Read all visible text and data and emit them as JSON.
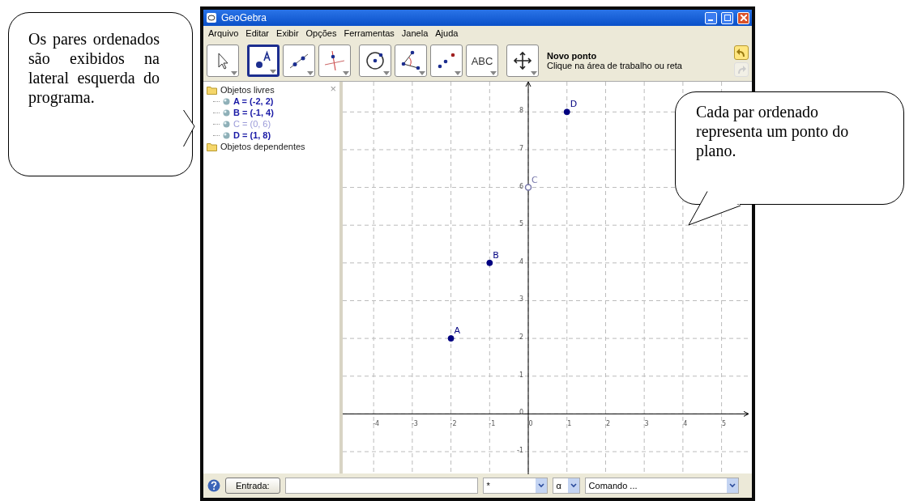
{
  "callouts": [
    {
      "kind": "left",
      "text": "Os pares ordenados são exibidos na lateral esquerda do programa."
    },
    {
      "kind": "right",
      "text": "Cada par ordenado representa um ponto do plano."
    }
  ],
  "window": {
    "title": "GeoGebra",
    "menu": [
      "Arquivo",
      "Editar",
      "Exibir",
      "Opções",
      "Ferramentas",
      "Janela",
      "Ajuda"
    ],
    "tools": [
      {
        "kind": "move",
        "selected": false
      },
      {
        "kind": "point",
        "selected": true
      },
      {
        "kind": "line",
        "selected": false
      },
      {
        "kind": "perpendicular",
        "selected": false
      },
      {
        "kind": "circle",
        "selected": false
      },
      {
        "kind": "angle",
        "selected": false
      },
      {
        "kind": "reflect",
        "selected": false
      },
      {
        "kind": "text",
        "label": "ABC",
        "selected": false
      },
      {
        "kind": "pan",
        "selected": false
      }
    ],
    "tool_info": {
      "title": "Novo ponto",
      "hint": "Clique na área de trabalho ou reta"
    },
    "actions": [
      {
        "kind": "undo",
        "disabled": false
      },
      {
        "kind": "redo",
        "disabled": true
      }
    ],
    "algebra_close": "×",
    "algebra_view": [
      {
        "label": "Objetos livres",
        "children": [
          {
            "label": "A = (-2, 2)",
            "dimmed": false
          },
          {
            "label": "B = (-1, 4)",
            "dimmed": false
          },
          {
            "label": "C = (0, 6)",
            "dimmed": true
          },
          {
            "label": "D = (1, 8)",
            "dimmed": false
          }
        ]
      },
      {
        "label": "Objetos dependentes"
      }
    ],
    "graphics": {
      "chart_data": {
        "type": "scatter",
        "x": [
          -2,
          -1,
          0,
          1
        ],
        "series": [
          {
            "color": "#000080",
            "values": [
              2,
              4,
              null,
              8
            ]
          },
          {
            "color": "#7777aa",
            "values": [
              null,
              null,
              6,
              null
            ]
          }
        ],
        "grid": true,
        "xlim": [
          -4.8,
          5.7
        ],
        "ylim": [
          -1.6,
          8.8
        ],
        "xticks": [
          -4,
          -3,
          -2,
          -1,
          0,
          1,
          2,
          3,
          4,
          5
        ],
        "yticks": [
          -1,
          0,
          1,
          2,
          3,
          4,
          5,
          6,
          7,
          8
        ],
        "annotations": [
          {
            "x": -2,
            "y": 2,
            "text": "A"
          },
          {
            "x": -1,
            "y": 4,
            "text": "B"
          },
          {
            "x": 0,
            "y": 6,
            "text": "C"
          },
          {
            "x": 1,
            "y": 8,
            "text": "D"
          }
        ]
      }
    },
    "input_bar": {
      "button": "Entrada:",
      "symbols": "*",
      "greek": "α",
      "commands": "Comando ..."
    }
  }
}
